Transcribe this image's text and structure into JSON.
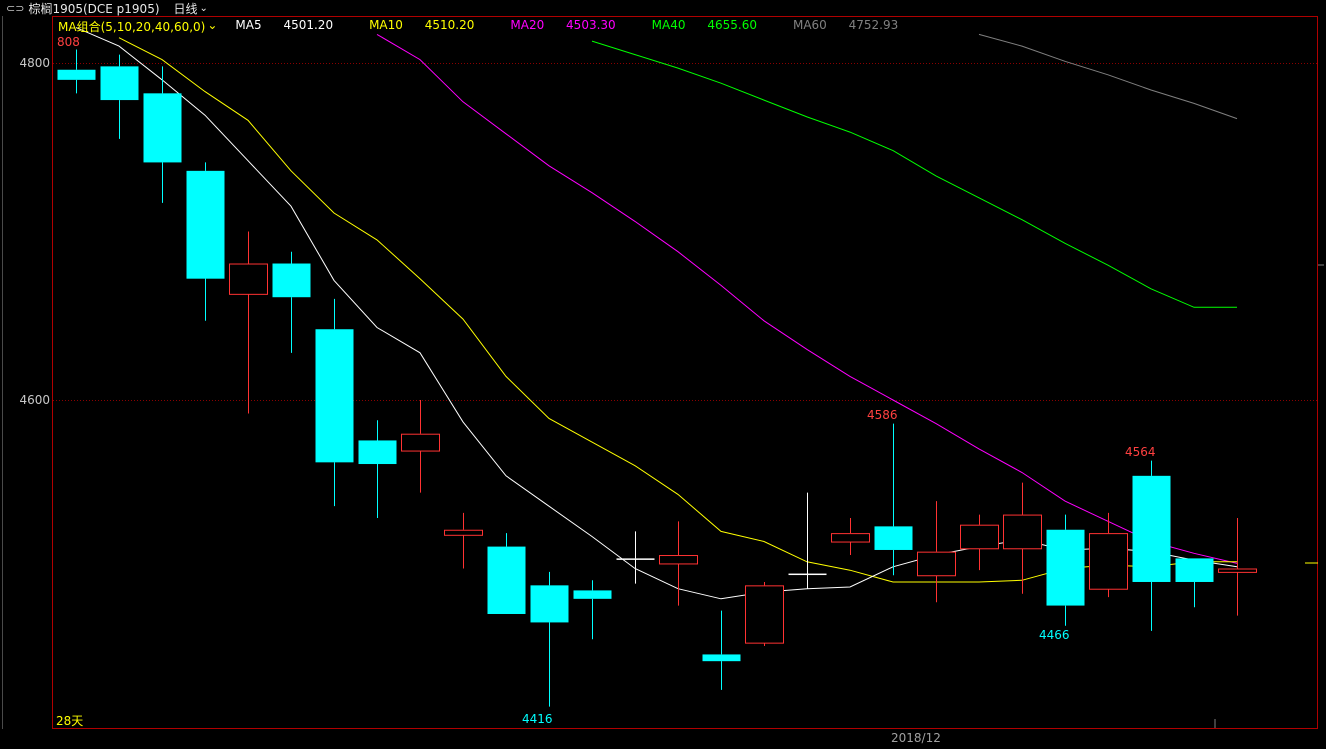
{
  "header": {
    "link_icon": "⊂⊃",
    "title": "棕榈1905(DCE p1905)",
    "period": "日线",
    "period_chevron": "chevron-down-icon"
  },
  "legend": {
    "group_label": "MA组合(5,10,20,40,60,0)",
    "group_color": "#ffff00",
    "items": [
      {
        "label": "MA5",
        "value": "4501.20",
        "color": "#ffffff"
      },
      {
        "label": "MA10",
        "value": "4510.20",
        "color": "#ffff00"
      },
      {
        "label": "MA20",
        "value": "4503.30",
        "color": "#ff00ff"
      },
      {
        "label": "MA40",
        "value": "4655.60",
        "color": "#00ff00"
      },
      {
        "label": "MA60",
        "value": "4752.93",
        "color": "#808080"
      }
    ]
  },
  "axis": {
    "ticks": [
      "4800",
      "4600"
    ],
    "top_value": "808",
    "days_label": "28天",
    "date_label": "2018/12"
  },
  "annotations": [
    {
      "text": "4586",
      "color": "#ff4040"
    },
    {
      "text": "4564",
      "color": "#ff4040"
    },
    {
      "text": "4466",
      "color": "#00ffff"
    },
    {
      "text": "4416",
      "color": "#00ffff"
    }
  ],
  "colors": {
    "up": "#ff3232",
    "down": "#00ffff",
    "flat": "#ffffff",
    "border": "#b00000",
    "grid": "#8a0000"
  },
  "chart_data": {
    "type": "candlestick",
    "title": "棕榈1905(DCE p1905)",
    "ylim": [
      4410,
      4820
    ],
    "yticks": [
      4800,
      4600
    ],
    "grid": true,
    "candles": [
      {
        "open": 4796,
        "high": 4808,
        "low": 4782,
        "close": 4790
      },
      {
        "open": 4798,
        "high": 4805,
        "low": 4755,
        "close": 4778
      },
      {
        "open": 4782,
        "high": 4798,
        "low": 4717,
        "close": 4741
      },
      {
        "open": 4736,
        "high": 4741,
        "low": 4647,
        "close": 4672
      },
      {
        "open": 4663,
        "high": 4700,
        "low": 4592,
        "close": 4681
      },
      {
        "open": 4681,
        "high": 4688,
        "low": 4628,
        "close": 4661
      },
      {
        "open": 4642,
        "high": 4660,
        "low": 4537,
        "close": 4563
      },
      {
        "open": 4576,
        "high": 4588,
        "low": 4530,
        "close": 4562
      },
      {
        "open": 4570,
        "high": 4600,
        "low": 4545,
        "close": 4580
      },
      {
        "open": 4520,
        "high": 4533,
        "low": 4500,
        "close": 4523
      },
      {
        "open": 4513,
        "high": 4521,
        "low": 4475,
        "close": 4473
      },
      {
        "open": 4490,
        "high": 4498,
        "low": 4418,
        "close": 4468
      },
      {
        "open": 4487,
        "high": 4493,
        "low": 4458,
        "close": 4482
      },
      {
        "open": 4506,
        "high": 4522,
        "low": 4491,
        "close": 4506
      },
      {
        "open": 4503,
        "high": 4528,
        "low": 4478,
        "close": 4508
      },
      {
        "open": 4449,
        "high": 4475,
        "low": 4428,
        "close": 4445
      },
      {
        "open": 4456,
        "high": 4492,
        "low": 4454,
        "close": 4490
      },
      {
        "open": 4497,
        "high": 4545,
        "low": 4488,
        "close": 4497
      },
      {
        "open": 4516,
        "high": 4530,
        "low": 4508,
        "close": 4521
      },
      {
        "open": 4525,
        "high": 4586,
        "low": 4496,
        "close": 4511
      },
      {
        "open": 4496,
        "high": 4540,
        "low": 4480,
        "close": 4510
      },
      {
        "open": 4512,
        "high": 4532,
        "low": 4499,
        "close": 4526
      },
      {
        "open": 4512,
        "high": 4551,
        "low": 4485,
        "close": 4532
      },
      {
        "open": 4523,
        "high": 4532,
        "low": 4466,
        "close": 4478
      },
      {
        "open": 4488,
        "high": 4533,
        "low": 4483,
        "close": 4521
      },
      {
        "open": 4555,
        "high": 4564,
        "low": 4463,
        "close": 4492
      },
      {
        "open": 4506,
        "high": 4506,
        "low": 4477,
        "close": 4492
      },
      {
        "open": 4498,
        "high": 4530,
        "low": 4472,
        "close": 4500
      }
    ],
    "ma5": [
      4821,
      4810,
      4790,
      4769,
      4742,
      4715,
      4671,
      4643,
      4628,
      4587,
      4555,
      4537,
      4519,
      4500,
      4488,
      4482,
      4486,
      4488,
      4489,
      4501,
      4508,
      4513,
      4517,
      4511,
      4512,
      4510,
      4505,
      4501
    ],
    "ma10": [
      null,
      4815,
      4802,
      4783,
      4766,
      4736,
      4711,
      4695,
      4672,
      4648,
      4614,
      4589,
      4575,
      4561,
      4544,
      4522,
      4516,
      4504,
      4499,
      4492,
      4492,
      4492,
      4493,
      4500,
      4502,
      4501,
      4504,
      4504
    ],
    "ma20": [
      null,
      null,
      null,
      null,
      null,
      null,
      null,
      4817,
      4802,
      4777,
      4758,
      4739,
      4723,
      4706,
      4688,
      4668,
      4647,
      4630,
      4614,
      4600,
      4586,
      4571,
      4557,
      4540,
      4528,
      4516,
      4509,
      4503
    ],
    "ma40": [
      null,
      null,
      null,
      null,
      null,
      null,
      null,
      null,
      null,
      null,
      null,
      null,
      4813,
      4805,
      4797,
      4788,
      4778,
      4768,
      4759,
      4748,
      4733,
      4720,
      4707,
      4693,
      4680,
      4666,
      4655,
      4655
    ],
    "ma60": [
      null,
      null,
      null,
      null,
      null,
      null,
      null,
      null,
      null,
      null,
      null,
      null,
      null,
      null,
      null,
      null,
      null,
      null,
      null,
      null,
      null,
      4817,
      4810,
      4801,
      4793,
      4784,
      4776,
      4767
    ]
  }
}
